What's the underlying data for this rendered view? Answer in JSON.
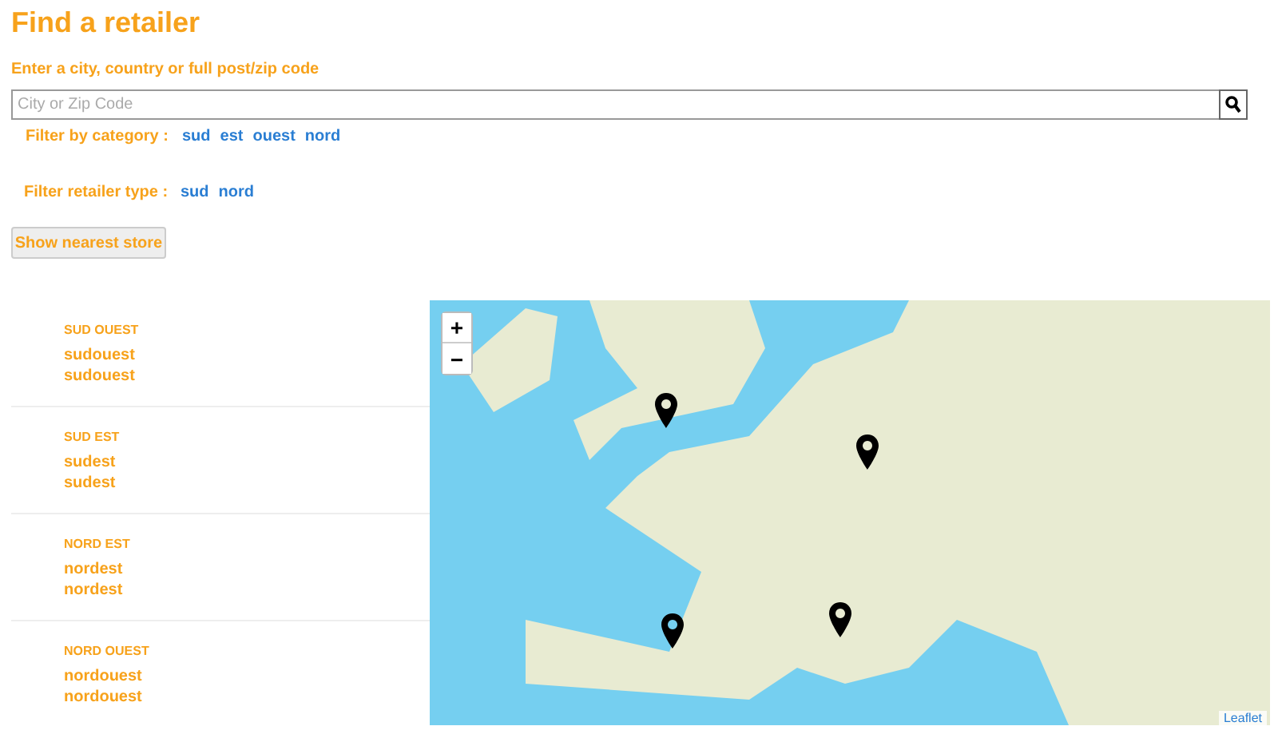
{
  "title": "Find a retailer",
  "search": {
    "label": "Enter a city, country or full post/zip code",
    "placeholder": "City or Zip Code"
  },
  "filters": [
    {
      "label": "Filter by category :",
      "options": [
        "sud",
        "est",
        "ouest",
        "nord"
      ]
    },
    {
      "label": "Filter retailer type :",
      "options": [
        "sud",
        "nord"
      ]
    }
  ],
  "button": "Show nearest store",
  "regions": [
    {
      "name": "SUD OUEST",
      "items": [
        "sudouest",
        "sudouest"
      ]
    },
    {
      "name": "SUD EST",
      "items": [
        "sudest",
        "sudest"
      ]
    },
    {
      "name": "NORD EST",
      "items": [
        "nordest",
        "nordest"
      ]
    },
    {
      "name": "NORD OUEST",
      "items": [
        "nordouest",
        "nordouest"
      ]
    }
  ],
  "map": {
    "zoom_in": "+",
    "zoom_out": "−",
    "attribution": "Leaflet"
  }
}
